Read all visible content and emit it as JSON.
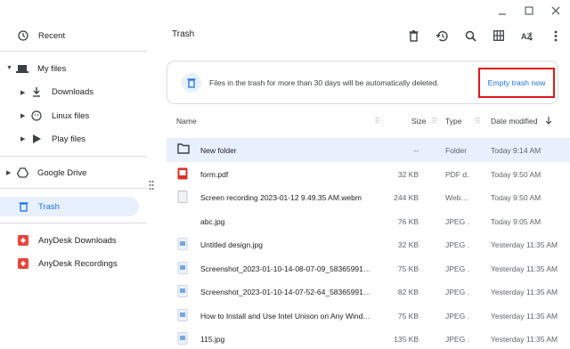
{
  "sidebar": {
    "recent": "Recent",
    "my_files": "My files",
    "downloads": "Downloads",
    "linux_files": "Linux files",
    "play_files": "Play files",
    "google_drive": "Google Drive",
    "trash": "Trash",
    "anydesk_downloads": "AnyDesk Downloads",
    "anydesk_recordings": "AnyDesk Recordings"
  },
  "header": {
    "title": "Trash"
  },
  "banner": {
    "message": "Files in the trash for more than 30 days will be automatically deleted.",
    "button": "Empty trash now"
  },
  "columns": {
    "name": "Name",
    "size": "Size",
    "type": "Type",
    "date": "Date modified"
  },
  "toolbar_icons": [
    "delete-icon",
    "restore-icon",
    "search-icon",
    "grid-view-icon",
    "sort-icon",
    "more-icon"
  ],
  "files": [
    {
      "name": "New folder",
      "size": "--",
      "type": "Folder",
      "date": "Today 9:14 AM",
      "icon": "folder"
    },
    {
      "name": "form.pdf",
      "size": "32 KB",
      "type": "PDF d…",
      "date": "Today 9:50 AM",
      "icon": "pdf"
    },
    {
      "name": "Screen recording 2023-01-12 9.49.35 AM.webm",
      "size": "244 KB",
      "type": "Web…",
      "date": "Today 9:50 AM",
      "icon": "video"
    },
    {
      "name": "abc.jpg",
      "size": "76 KB",
      "type": "JPEG …",
      "date": "Today 9:05 AM",
      "icon": "blank"
    },
    {
      "name": "Untitled design.jpg",
      "size": "32 KB",
      "type": "JPEG …",
      "date": "Yesterday 11:35 AM",
      "icon": "image"
    },
    {
      "name": "Screenshot_2023-01-10-14-08-07-09_58365991…",
      "size": "75 KB",
      "type": "JPEG …",
      "date": "Yesterday 11:35 AM",
      "icon": "image"
    },
    {
      "name": "Screenshot_2023-01-10-14-07-52-64_58365991…",
      "size": "82 KB",
      "type": "JPEG …",
      "date": "Yesterday 11:35 AM",
      "icon": "image"
    },
    {
      "name": "How to Install and Use Intel Unison on Any Wind…",
      "size": "75 KB",
      "type": "JPEG …",
      "date": "Yesterday 11:35 AM",
      "icon": "image"
    },
    {
      "name": "115.jpg",
      "size": "135 KB",
      "type": "JPEG …",
      "date": "Yesterday 11:35 AM",
      "icon": "image"
    }
  ],
  "colors": {
    "accent": "#1a73e8",
    "selected": "#e8f0fe",
    "highlight_border": "#e0181b"
  }
}
